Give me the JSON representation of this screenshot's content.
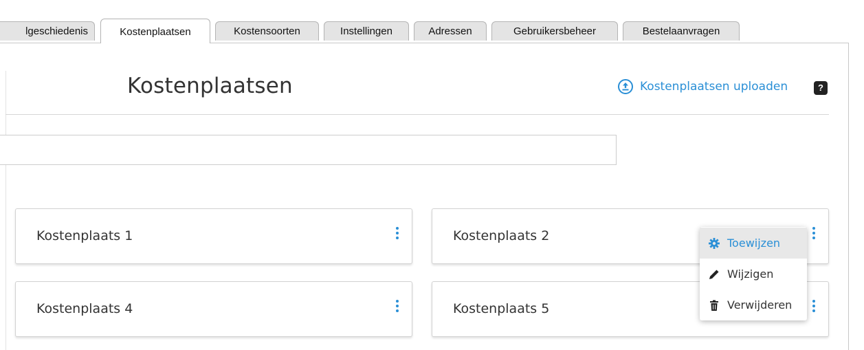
{
  "tabs": [
    {
      "label": "lgeschiedenis",
      "active": false
    },
    {
      "label": "Kostenplaatsen",
      "active": true
    },
    {
      "label": "Kostensoorten",
      "active": false
    },
    {
      "label": "Instellingen",
      "active": false
    },
    {
      "label": "Adressen",
      "active": false
    },
    {
      "label": "Gebruikersbeheer",
      "active": false
    },
    {
      "label": "Bestelaanvragen",
      "active": false
    }
  ],
  "header": {
    "title": "Kostenplaatsen",
    "upload_label": "Kostenplaatsen uploaden",
    "upload_icon": "upload-circle-icon",
    "help_label": "?"
  },
  "search": {
    "value": "",
    "placeholder": ""
  },
  "cards": [
    {
      "label": "Kostenplaats 1"
    },
    {
      "label": "Kostenplaats 2"
    },
    {
      "label": "Kostenplaats 4"
    },
    {
      "label": "Kostenplaats 5"
    }
  ],
  "menu": {
    "items": [
      {
        "label": "Toewijzen",
        "icon": "gear-icon",
        "highlighted": true
      },
      {
        "label": "Wijzigen",
        "icon": "pencil-icon",
        "highlighted": false
      },
      {
        "label": "Verwijderen",
        "icon": "trash-icon",
        "highlighted": false
      }
    ]
  },
  "colors": {
    "accent": "#2a8fd6",
    "tab_inactive": "#e4e4e4",
    "menu_highlight": "#e8e8e8"
  }
}
